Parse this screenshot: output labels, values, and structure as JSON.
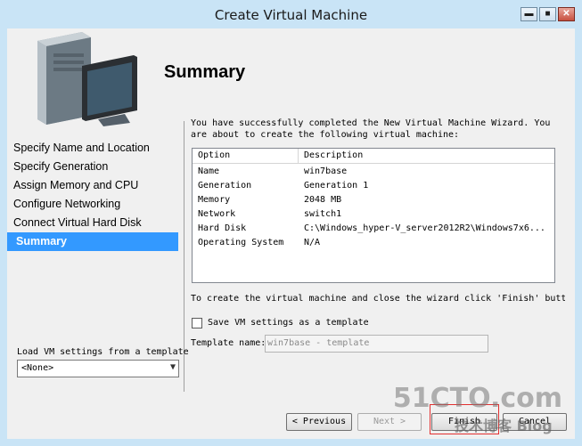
{
  "window": {
    "title": "Create Virtual Machine",
    "min_glyph": "▬",
    "max_glyph": "■",
    "close_glyph": "✕"
  },
  "page": {
    "heading": "Summary"
  },
  "nav": {
    "items": [
      {
        "label": "Specify Name and Location"
      },
      {
        "label": "Specify Generation"
      },
      {
        "label": "Assign Memory and CPU"
      },
      {
        "label": "Configure Networking"
      },
      {
        "label": "Connect Virtual Hard Disk"
      },
      {
        "label": "Summary",
        "selected": true
      }
    ]
  },
  "summary": {
    "intro_line1": "You have successfully completed the New Virtual Machine Wizard. You",
    "intro_line2": "are about to create the following virtual machine:",
    "columns": {
      "option": "Option",
      "description": "Description"
    },
    "rows": [
      {
        "option": "Name",
        "description": "win7base"
      },
      {
        "option": "Generation",
        "description": "Generation 1"
      },
      {
        "option": "Memory",
        "description": "2048 MB"
      },
      {
        "option": "Network",
        "description": "switch1"
      },
      {
        "option": "Hard Disk",
        "description": "C:\\Windows_hyper-V_server2012R2\\Windows7x6..."
      },
      {
        "option": "Operating System",
        "description": "N/A"
      }
    ],
    "finish_text": "To create the virtual machine and close the wizard click 'Finish' butt"
  },
  "template": {
    "checkbox_label": "Save VM settings as a template",
    "checked": false,
    "name_label": "Template name:",
    "name_value": "win7base - template"
  },
  "load": {
    "label": "Load VM settings from a template",
    "selected": "<None>"
  },
  "buttons": {
    "previous": "< Previous",
    "next": "Next >",
    "finish": "Finish",
    "cancel": "Cancel"
  },
  "watermark": {
    "logo": "51CTO.com",
    "text": "技术博客  Blog"
  }
}
